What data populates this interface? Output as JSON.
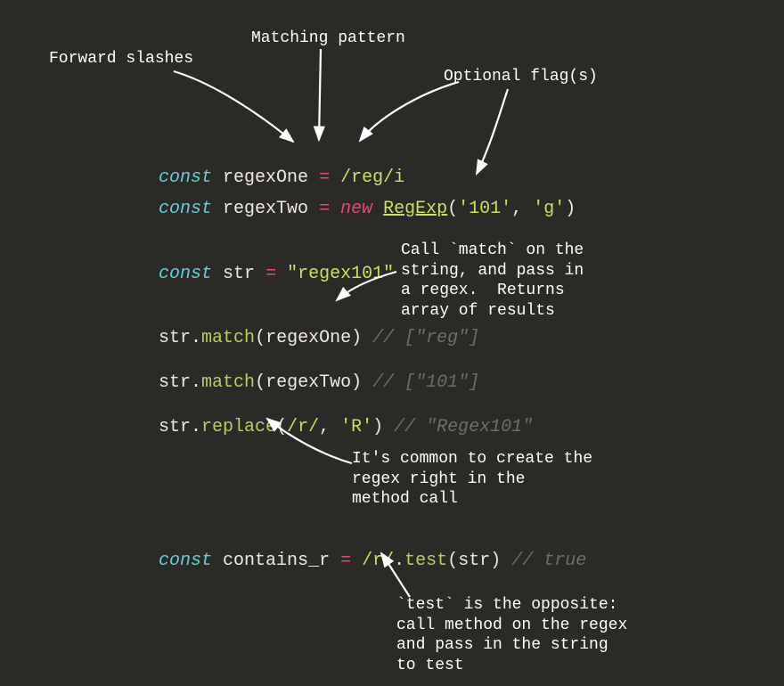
{
  "annotations": {
    "forward_slashes": "Forward slashes",
    "matching_pattern": "Matching pattern",
    "optional_flags": "Optional flag(s)",
    "call_match": "Call `match` on the\nstring, and pass in\na regex.  Returns\narray of results",
    "inline_regex": "It's common to create the\nregex right in the\nmethod call",
    "test_opposite": "`test` is the opposite:\ncall method on the regex\nand pass in the string\nto test"
  },
  "code": {
    "line1": {
      "const": "const",
      "sp1": " ",
      "var": "regexOne",
      "sp2": " ",
      "eq": "=",
      "sp3": " ",
      "regex": "/reg/i"
    },
    "line2": {
      "const": "const",
      "sp1": " ",
      "var": "regexTwo",
      "sp2": " ",
      "eq": "=",
      "sp3": " ",
      "new": "new",
      "sp4": " ",
      "ctor": "RegExp",
      "open": "(",
      "arg1": "'101'",
      "comma": ", ",
      "arg2": "'g'",
      "close": ")"
    },
    "line3": {
      "const": "const",
      "sp1": " ",
      "var": "str",
      "sp2": " ",
      "eq": "=",
      "sp3": " ",
      "val": "\"regex101\""
    },
    "line4": {
      "obj": "str",
      "dot": ".",
      "method": "match",
      "open": "(",
      "arg": "regexOne",
      "close": ")",
      "sp": " ",
      "comment": "// [\"reg\"]"
    },
    "line5": {
      "obj": "str",
      "dot": ".",
      "method": "match",
      "open": "(",
      "arg": "regexTwo",
      "close": ")",
      "sp": " ",
      "comment": "// [\"101\"]"
    },
    "line6": {
      "obj": "str",
      "dot": ".",
      "method": "replace",
      "open": "(",
      "arg1": "/r/",
      "comma": ", ",
      "arg2": "'R'",
      "close": ")",
      "sp": " ",
      "comment": "// \"Regex101\""
    },
    "line7": {
      "const": "const",
      "sp1": " ",
      "var": "contains_r",
      "sp2": " ",
      "eq": "=",
      "sp3": " ",
      "regex": "/r/",
      "dot": ".",
      "method": "test",
      "open": "(",
      "arg": "str",
      "close": ")",
      "sp": " ",
      "comment": "// true"
    }
  }
}
